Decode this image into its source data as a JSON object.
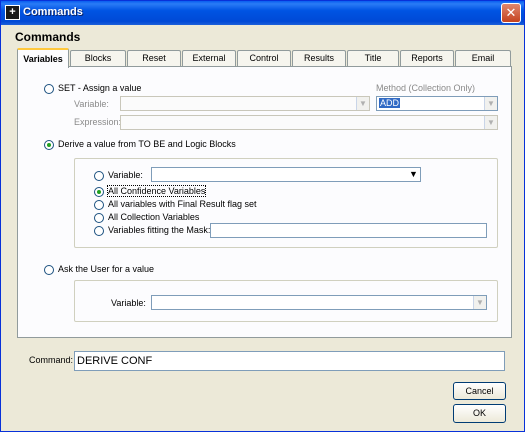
{
  "window": {
    "title": "Commands",
    "close_symbol": "✕"
  },
  "heading": "Commands",
  "tabs": [
    "Variables",
    "Blocks",
    "Reset",
    "External",
    "Control",
    "Results",
    "Title",
    "Reports",
    "Email"
  ],
  "set_section": {
    "radio_label": "SET - Assign a value",
    "variable_label": "Variable:",
    "expression_label": "Expression:",
    "method_label": "Method (Collection Only)",
    "method_value": "ADD"
  },
  "derive_section": {
    "radio_label": "Derive a value from TO BE and Logic Blocks",
    "variable_label": "Variable:",
    "options": [
      "All Confidence Variables",
      "All variables with Final Result flag set",
      "All Collection Variables",
      "Variables fitting the Mask:"
    ]
  },
  "ask_section": {
    "radio_label": "Ask the User for a value",
    "variable_label": "Variable:"
  },
  "command": {
    "label": "Command:",
    "value": "DERIVE CONF"
  },
  "buttons": {
    "cancel": "Cancel",
    "ok": "OK"
  }
}
